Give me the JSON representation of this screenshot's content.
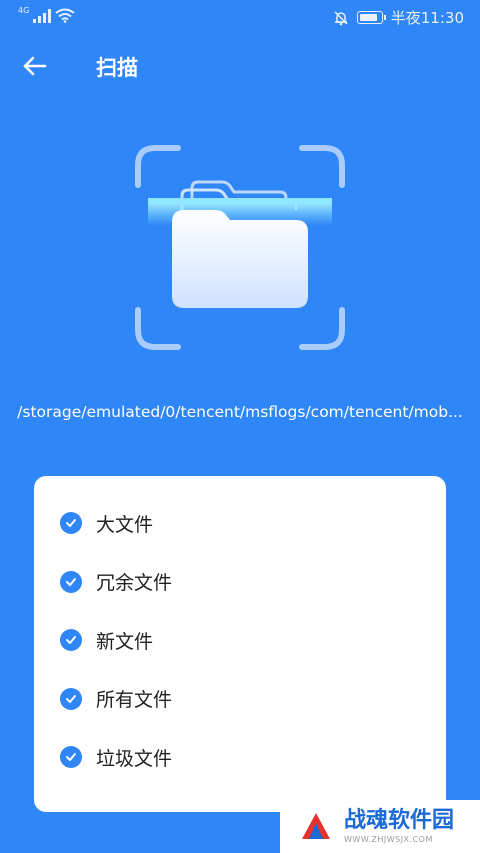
{
  "status_bar": {
    "network": "4G",
    "time_label": "半夜11:30",
    "icons": [
      "signal-icon",
      "wifi-icon",
      "bell-off-icon",
      "battery-icon"
    ]
  },
  "header": {
    "back_icon": "arrow-left-icon",
    "title": "扫描"
  },
  "scan": {
    "illustration": "folder-scan-illustration",
    "current_path": "/storage/emulated/0/tencent/msflogs/com/tencent/mob..."
  },
  "scan_types": {
    "items": [
      {
        "label": "大文件",
        "checked": true
      },
      {
        "label": "冗余文件",
        "checked": true
      },
      {
        "label": "新文件",
        "checked": true
      },
      {
        "label": "所有文件",
        "checked": true
      },
      {
        "label": "垃圾文件",
        "checked": true
      }
    ]
  },
  "watermark": {
    "name": "战魂软件园",
    "url": "WWW.ZHJWSJX.COM"
  },
  "colors": {
    "background": "#2f86f6",
    "card": "#ffffff",
    "check": "#2f86f6"
  }
}
